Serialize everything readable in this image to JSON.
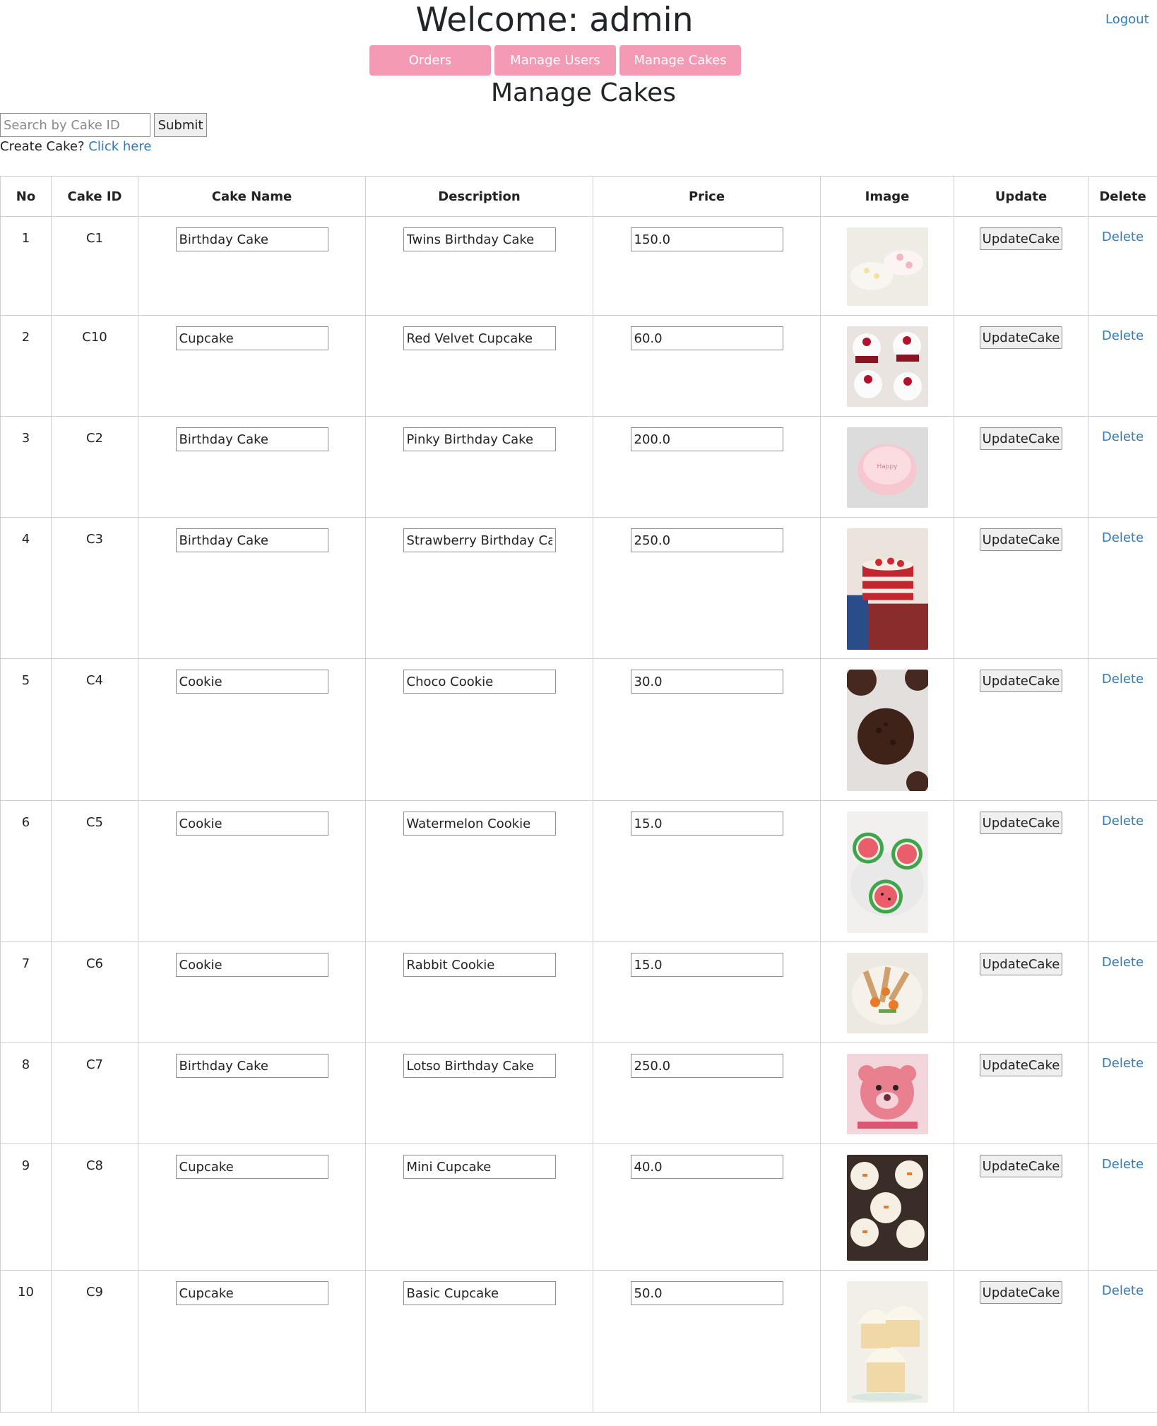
{
  "header": {
    "title": "Welcome: admin",
    "logout_label": "Logout"
  },
  "nav": {
    "orders_label": "Orders",
    "manage_users_label": "Manage Users",
    "manage_cakes_label": "Manage Cakes",
    "color": "#f49ab5"
  },
  "page": {
    "title": "Manage Cakes"
  },
  "search": {
    "placeholder": "Search by Cake ID",
    "value": "",
    "submit_label": "Submit"
  },
  "create": {
    "prompt": "Create Cake?",
    "link_label": "Click here"
  },
  "table": {
    "headers": [
      "No",
      "Cake ID",
      "Cake Name",
      "Description",
      "Price",
      "Image",
      "Update",
      "Delete"
    ],
    "update_label": "UpdateCake",
    "delete_label": "Delete",
    "rows": [
      {
        "no": "1",
        "id": "C1",
        "name": "Birthday Cake",
        "description": "Twins Birthday Cake",
        "price": "150.0",
        "image": "twin-cakes-photo"
      },
      {
        "no": "2",
        "id": "C10",
        "name": "Cupcake",
        "description": "Red Velvet Cupcake",
        "price": "60.0",
        "image": "red-velvet-cupcakes-photo"
      },
      {
        "no": "3",
        "id": "C2",
        "name": "Birthday Cake",
        "description": "Pinky Birthday Cake",
        "price": "200.0",
        "image": "pink-cake-photo"
      },
      {
        "no": "4",
        "id": "C3",
        "name": "Birthday Cake",
        "description": "Strawberry Birthday Cake",
        "price": "250.0",
        "image": "strawberry-cake-photo"
      },
      {
        "no": "5",
        "id": "C4",
        "name": "Cookie",
        "description": "Choco Cookie",
        "price": "30.0",
        "image": "choco-cookie-photo"
      },
      {
        "no": "6",
        "id": "C5",
        "name": "Cookie",
        "description": "Watermelon Cookie",
        "price": "15.0",
        "image": "watermelon-cookie-photo"
      },
      {
        "no": "7",
        "id": "C6",
        "name": "Cookie",
        "description": "Rabbit Cookie",
        "price": "15.0",
        "image": "rabbit-cookie-photo"
      },
      {
        "no": "8",
        "id": "C7",
        "name": "Birthday Cake",
        "description": "Lotso Birthday Cake",
        "price": "250.0",
        "image": "lotso-cake-photo"
      },
      {
        "no": "9",
        "id": "C8",
        "name": "Cupcake",
        "description": "Mini Cupcake",
        "price": "40.0",
        "image": "mini-cupcake-photo"
      },
      {
        "no": "10",
        "id": "C9",
        "name": "Cupcake",
        "description": "Basic Cupcake",
        "price": "50.0",
        "image": "basic-cupcake-photo"
      }
    ]
  }
}
